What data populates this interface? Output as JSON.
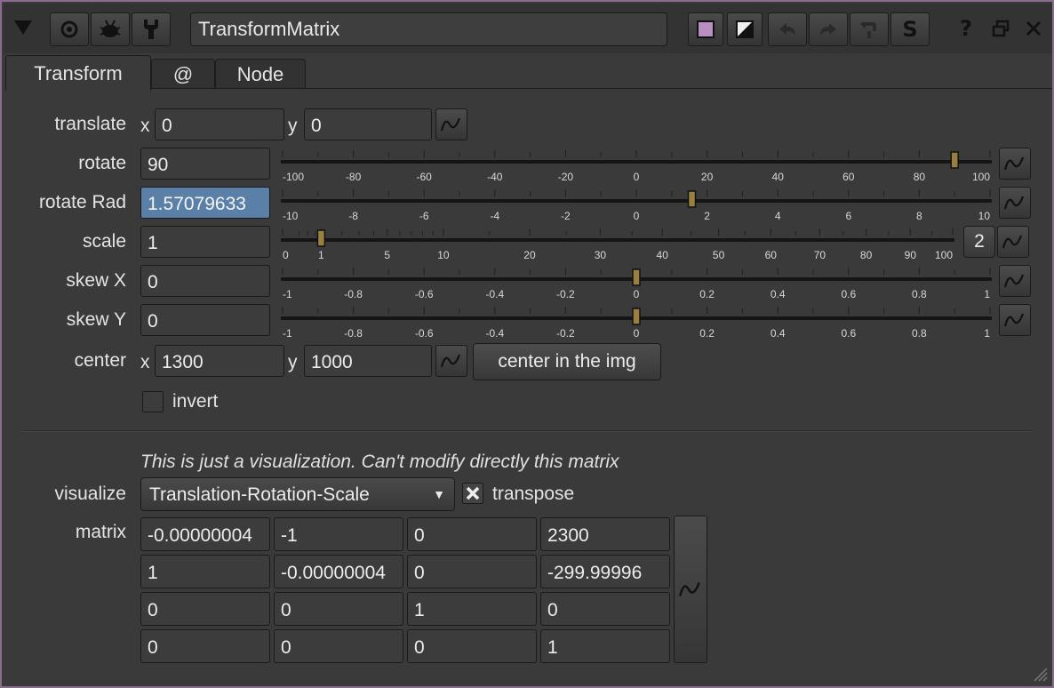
{
  "toolbar": {
    "node_name": "TransformMatrix",
    "icons": [
      "collapse-triangle-icon",
      "center-viewer-icon",
      "insect-icon",
      "wrench-icon",
      "color-swatch-icon",
      "no-color-icon",
      "undo-icon",
      "redo-icon",
      "revert-icon",
      "script-icon",
      "help-icon",
      "float-icon",
      "close-icon"
    ],
    "swatch_color": "#b98ec2",
    "help": "?",
    "script": "S"
  },
  "tabs": [
    "Transform",
    "@",
    "Node"
  ],
  "knobs": {
    "translate": {
      "label": "translate",
      "x_label": "x",
      "x": "0",
      "y_label": "y",
      "y": "0"
    },
    "rotate": {
      "label": "rotate",
      "value": "90",
      "ticks": [
        "-100",
        "-80",
        "-60",
        "-40",
        "-20",
        "0",
        "20",
        "40",
        "60",
        "80",
        "100"
      ],
      "min": -100,
      "max": 100,
      "handle": 90
    },
    "rotate_rad": {
      "label": "rotate Rad",
      "value": "1.57079633",
      "ticks": [
        "-10",
        "-8",
        "-6",
        "-4",
        "-2",
        "0",
        "2",
        "4",
        "6",
        "8",
        "10"
      ],
      "min": -10,
      "max": 10,
      "handle": 1.57079633
    },
    "scale": {
      "label": "scale",
      "value": "1",
      "dim_button": "2",
      "ticks": [
        "0",
        "1",
        "5",
        "10",
        "20",
        "30",
        "40",
        "50",
        "60",
        "70",
        "80",
        "90",
        "100"
      ],
      "handle": 1
    },
    "skew_x": {
      "label": "skew X",
      "value": "0",
      "ticks": [
        "-1",
        "-0.8",
        "-0.6",
        "-0.4",
        "-0.2",
        "0",
        "0.2",
        "0.4",
        "0.6",
        "0.8",
        "1"
      ],
      "min": -1,
      "max": 1,
      "handle": 0
    },
    "skew_y": {
      "label": "skew Y",
      "value": "0",
      "ticks": [
        "-1",
        "-0.8",
        "-0.6",
        "-0.4",
        "-0.2",
        "0",
        "0.2",
        "0.4",
        "0.6",
        "0.8",
        "1"
      ],
      "min": -1,
      "max": 1,
      "handle": 0
    },
    "center": {
      "label": "center",
      "x_label": "x",
      "x": "1300",
      "y_label": "y",
      "y": "1000",
      "button": "center in the img"
    },
    "invert": {
      "label": "invert",
      "checked": false
    }
  },
  "visualization": {
    "note": "This is just a visualization. Can't modify directly this matrix",
    "visualize_label": "visualize",
    "visualize_value": "Translation-Rotation-Scale",
    "transpose_label": "transpose",
    "transpose_checked": true,
    "matrix_label": "matrix",
    "matrix": [
      [
        "-0.00000004",
        "-1",
        "0",
        "2300"
      ],
      [
        "1",
        "-0.00000004",
        "0",
        "-299.99996"
      ],
      [
        "0",
        "0",
        "1",
        "0"
      ],
      [
        "0",
        "0",
        "0",
        "1"
      ]
    ]
  }
}
